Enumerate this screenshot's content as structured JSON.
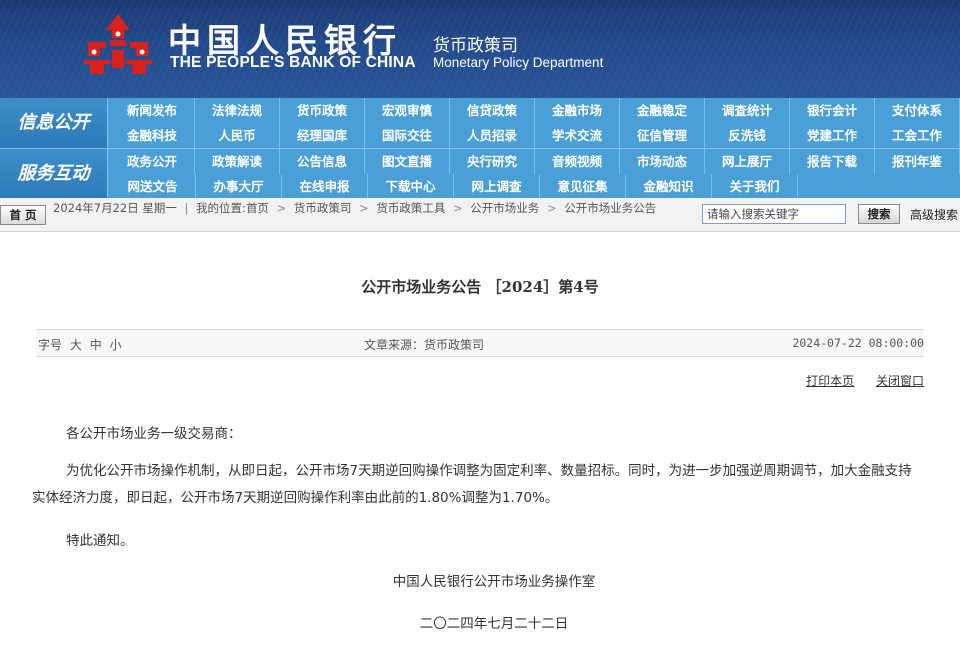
{
  "header": {
    "bank_cn": "中国人民银行",
    "bank_en": "THE PEOPLE'S BANK OF CHINA",
    "dept_cn": "货币政策司",
    "dept_en": "Monetary Policy Department"
  },
  "nav": {
    "group1_label": "信息公开",
    "group1_row1": [
      "新闻发布",
      "法律法规",
      "货币政策",
      "宏观审慎",
      "信贷政策",
      "金融市场",
      "金融稳定",
      "调查统计",
      "银行会计",
      "支付体系"
    ],
    "group1_row2": [
      "金融科技",
      "人民币",
      "经理国库",
      "国际交往",
      "人员招录",
      "学术交流",
      "征信管理",
      "反洗钱",
      "党建工作",
      "工会工作"
    ],
    "group2_label": "服务互动",
    "group2_row1": [
      "政务公开",
      "政策解读",
      "公告信息",
      "图文直播",
      "央行研究",
      "音频视频",
      "市场动态",
      "网上展厅",
      "报告下载",
      "报刊年鉴"
    ],
    "group2_row2": [
      "网送文告",
      "办事大厅",
      "在线申报",
      "下载中心",
      "网上调查",
      "意见征集",
      "金融知识",
      "关于我们"
    ]
  },
  "crumb": {
    "home": "首 页",
    "date": "2024年7月22日 星期一",
    "location_label": "我的位置:",
    "items": [
      "首页",
      "货币政策司",
      "货币政策工具",
      "公开市场业务",
      "公开市场业务公告"
    ],
    "search_placeholder": "请输入搜索关键字",
    "search_btn": "搜索",
    "advanced": "高级搜索"
  },
  "article": {
    "title": "公开市场业务公告 ［2024］第4号",
    "font_size_label": "字号",
    "size_large": "大",
    "size_medium": "中",
    "size_small": "小",
    "source": "文章来源：货币政策司",
    "date": "2024-07-22 08:00:00",
    "print": "打印本页",
    "close": "关闭窗口",
    "greeting": "各公开市场业务一级交易商：",
    "paragraph": "为优化公开市场操作机制，从即日起，公开市场7天期逆回购操作调整为固定利率、数量招标。同时，为进一步加强逆周期调节，加大金融支持实体经济力度，即日起，公开市场7天期逆回购操作利率由此前的1.80%调整为1.70%。",
    "closing": "特此通知。",
    "signature": "中国人民银行公开市场业务操作室",
    "sign_date": "二〇二四年七月二十二日"
  },
  "colors": {
    "banner": "#234a8c",
    "nav": "#4a9fd6",
    "logo_red": "#d9221c"
  }
}
